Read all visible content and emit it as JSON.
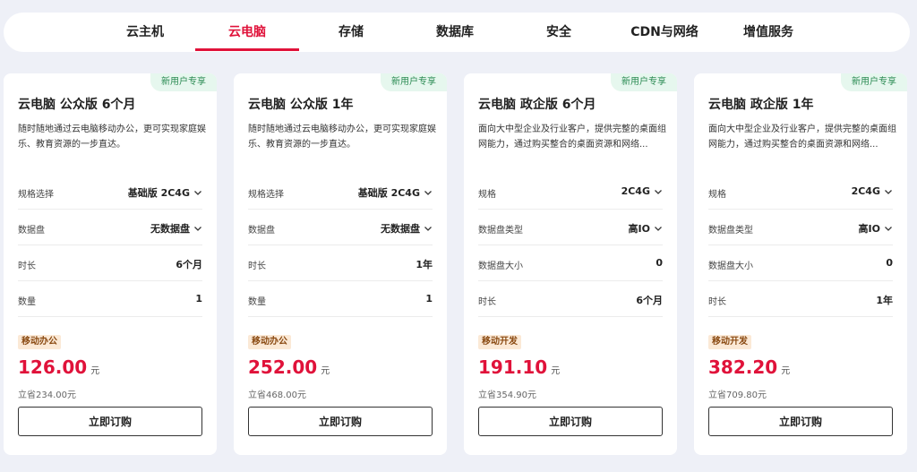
{
  "nav": {
    "tabs": [
      {
        "label": "云主机"
      },
      {
        "label": "云电脑"
      },
      {
        "label": "存储"
      },
      {
        "label": "数据库"
      },
      {
        "label": "安全"
      },
      {
        "label": "CDN与网络"
      },
      {
        "label": "增值服务"
      }
    ],
    "active_index": 1
  },
  "colors": {
    "accent": "#e0123a",
    "badge_bg": "#e6f7ee",
    "badge_text": "#2a8a52",
    "tag_bg": "#fbe9d6",
    "tag_text": "#8a4a12",
    "page_bg": "#eef0f7"
  },
  "icons": {
    "dropdown": "chevron-down-icon"
  },
  "cards": [
    {
      "badge": "新用户专享",
      "title": "云电脑 公众版 6个月",
      "description": "随时随地通过云电脑移动办公，更可实现家庭娱乐、教育资源的一步直达。",
      "rows": [
        {
          "label": "规格选择",
          "value": "基础版 2C4G",
          "dropdown": true
        },
        {
          "label": "数据盘",
          "value": "无数据盘",
          "dropdown": true
        },
        {
          "label": "时长",
          "value": "6个月",
          "dropdown": false
        },
        {
          "label": "数量",
          "value": "1",
          "dropdown": false
        }
      ],
      "tag": "移动办公",
      "price": "126.00",
      "price_unit": "元",
      "savings": "立省234.00元",
      "buy_label": "立即订购"
    },
    {
      "badge": "新用户专享",
      "title": "云电脑 公众版 1年",
      "description": "随时随地通过云电脑移动办公，更可实现家庭娱乐、教育资源的一步直达。",
      "rows": [
        {
          "label": "规格选择",
          "value": "基础版 2C4G",
          "dropdown": true
        },
        {
          "label": "数据盘",
          "value": "无数据盘",
          "dropdown": true
        },
        {
          "label": "时长",
          "value": "1年",
          "dropdown": false
        },
        {
          "label": "数量",
          "value": "1",
          "dropdown": false
        }
      ],
      "tag": "移动办公",
      "price": "252.00",
      "price_unit": "元",
      "savings": "立省468.00元",
      "buy_label": "立即订购"
    },
    {
      "badge": "新用户专享",
      "title": "云电脑 政企版 6个月",
      "description": "面向大中型企业及行业客户，提供完整的桌面组网能力，通过购买整合的桌面资源和网络...",
      "rows": [
        {
          "label": "规格",
          "value": "2C4G",
          "dropdown": true
        },
        {
          "label": "数据盘类型",
          "value": "高IO",
          "dropdown": true
        },
        {
          "label": "数据盘大小",
          "value": "0",
          "dropdown": false
        },
        {
          "label": "时长",
          "value": "6个月",
          "dropdown": false
        }
      ],
      "tag": "移动开发",
      "price": "191.10",
      "price_unit": "元",
      "savings": "立省354.90元",
      "buy_label": "立即订购"
    },
    {
      "badge": "新用户专享",
      "title": "云电脑 政企版 1年",
      "description": "面向大中型企业及行业客户，提供完整的桌面组网能力，通过购买整合的桌面资源和网络...",
      "rows": [
        {
          "label": "规格",
          "value": "2C4G",
          "dropdown": true
        },
        {
          "label": "数据盘类型",
          "value": "高IO",
          "dropdown": true
        },
        {
          "label": "数据盘大小",
          "value": "0",
          "dropdown": false
        },
        {
          "label": "时长",
          "value": "1年",
          "dropdown": false
        }
      ],
      "tag": "移动开发",
      "price": "382.20",
      "price_unit": "元",
      "savings": "立省709.80元",
      "buy_label": "立即订购"
    }
  ]
}
